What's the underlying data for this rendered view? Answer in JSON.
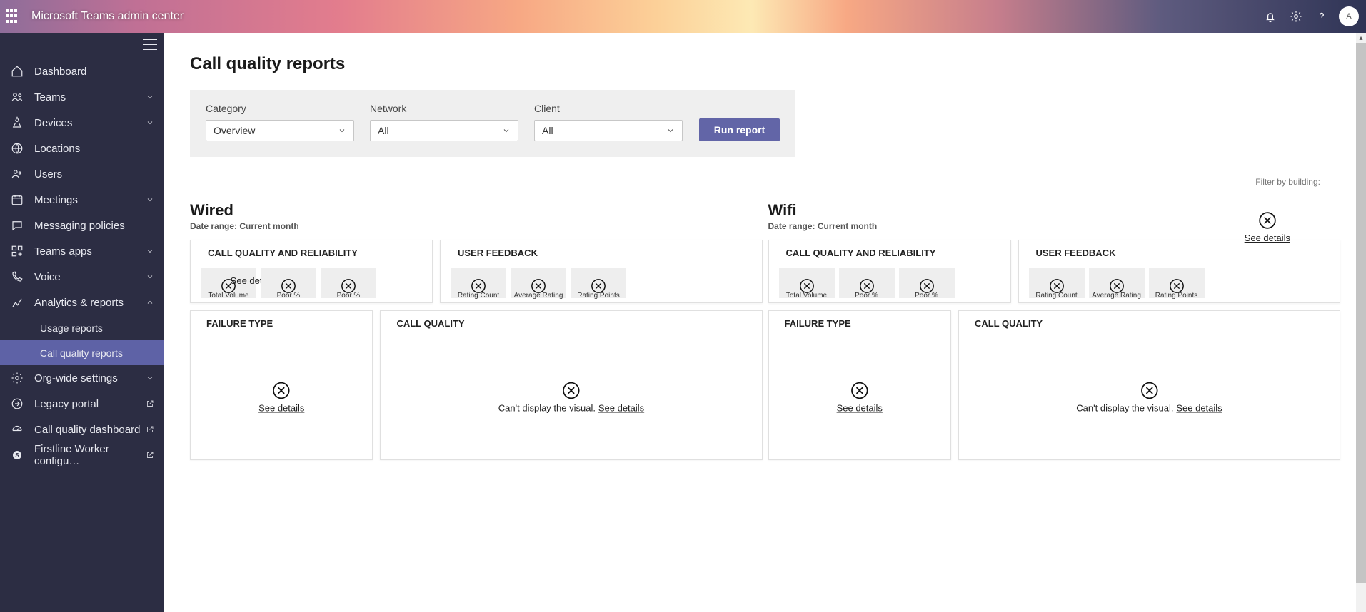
{
  "header": {
    "title": "Microsoft Teams admin center",
    "avatar_initials": "A"
  },
  "sidebar": {
    "items": [
      {
        "label": "Dashboard",
        "expandable": false
      },
      {
        "label": "Teams",
        "expandable": true
      },
      {
        "label": "Devices",
        "expandable": true
      },
      {
        "label": "Locations",
        "expandable": false
      },
      {
        "label": "Users",
        "expandable": false
      },
      {
        "label": "Meetings",
        "expandable": true
      },
      {
        "label": "Messaging policies",
        "expandable": false
      },
      {
        "label": "Teams apps",
        "expandable": true
      },
      {
        "label": "Voice",
        "expandable": true
      },
      {
        "label": "Analytics & reports",
        "expandable": true
      },
      {
        "label": "Usage reports"
      },
      {
        "label": "Call quality reports"
      },
      {
        "label": "Org-wide settings",
        "expandable": true
      },
      {
        "label": "Legacy portal",
        "external": true
      },
      {
        "label": "Call quality dashboard",
        "external": true
      },
      {
        "label": "Firstline Worker configu…",
        "external": true
      }
    ]
  },
  "page": {
    "title": "Call quality reports",
    "filters": {
      "category_label": "Category",
      "category_value": "Overview",
      "network_label": "Network",
      "network_value": "All",
      "client_label": "Client",
      "client_value": "All",
      "run_button": "Run report"
    },
    "filter_by_building": "Filter by building:",
    "see_details": "See details",
    "cant_display": "Can't display the visual.",
    "stats": {
      "a": "Total Volume",
      "b": "Poor %",
      "c": "Poor %",
      "rc": "Rating Count",
      "ar": "Average Rating",
      "rp": "Rating Points"
    },
    "wired": {
      "title": "Wired",
      "range": "Date range: Current month",
      "cqr": "CALL QUALITY AND RELIABILITY",
      "uf": "USER FEEDBACK",
      "ft": "FAILURE TYPE",
      "cq": "CALL QUALITY"
    },
    "wifi": {
      "title": "Wifi",
      "range": "Date range: Current month",
      "cqr": "CALL QUALITY AND RELIABILITY",
      "uf": "USER FEEDBACK",
      "ft": "FAILURE TYPE",
      "cq": "CALL QUALITY"
    }
  }
}
